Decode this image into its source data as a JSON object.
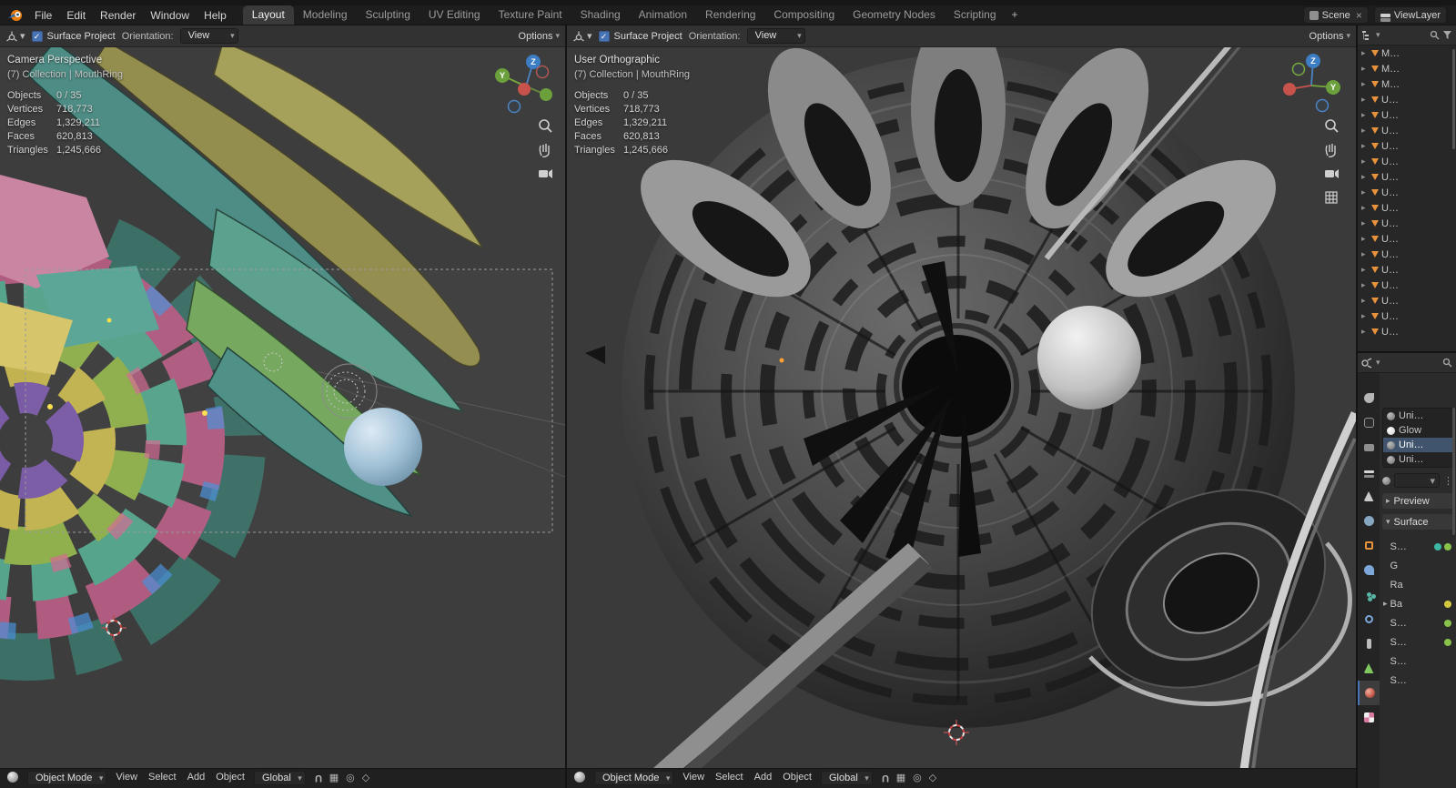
{
  "icons": {
    "chevron": "▾",
    "check": "✓",
    "close": "×",
    "caret_right": "▸",
    "caret_down": "▾",
    "dots": "⋮",
    "proportional": "◎",
    "snap": "▦",
    "falloff": "◇",
    "magnet": "U"
  },
  "topbar": {
    "menus": [
      "File",
      "Edit",
      "Render",
      "Window",
      "Help"
    ],
    "workspaces": [
      {
        "label": "Layout",
        "active": true
      },
      {
        "label": "Modeling"
      },
      {
        "label": "Sculpting"
      },
      {
        "label": "UV Editing"
      },
      {
        "label": "Texture Paint"
      },
      {
        "label": "Shading"
      },
      {
        "label": "Animation"
      },
      {
        "label": "Rendering"
      },
      {
        "label": "Compositing"
      },
      {
        "label": "Geometry Nodes"
      },
      {
        "label": "Scripting"
      }
    ],
    "add_workspace": "+",
    "scene": {
      "label": "Scene"
    },
    "view_layer": {
      "label": "ViewLayer"
    }
  },
  "viewport_left": {
    "header": {
      "surface_project_label": "Surface Project",
      "orientation_label": "Orientation:",
      "orientation_value": "View",
      "options_label": "Options"
    },
    "overlay": {
      "view_name": "Camera Perspective",
      "context": "(7) Collection | MouthRing",
      "stats": [
        {
          "label": "Objects",
          "value": "0 / 35"
        },
        {
          "label": "Vertices",
          "value": "718,773"
        },
        {
          "label": "Edges",
          "value": "1,329,211"
        },
        {
          "label": "Faces",
          "value": "620,813"
        },
        {
          "label": "Triangles",
          "value": "1,245,666"
        }
      ]
    },
    "footer": {
      "mode": "Object Mode",
      "menus": [
        "View",
        "Select",
        "Add",
        "Object"
      ],
      "orientation": "Global"
    }
  },
  "viewport_right": {
    "header": {
      "surface_project_label": "Surface Project",
      "orientation_label": "Orientation:",
      "orientation_value": "View",
      "options_label": "Options"
    },
    "overlay": {
      "view_name": "User Orthographic",
      "context": "(7) Collection | MouthRing",
      "stats": [
        {
          "label": "Objects",
          "value": "0 / 35"
        },
        {
          "label": "Vertices",
          "value": "718,773"
        },
        {
          "label": "Edges",
          "value": "1,329,211"
        },
        {
          "label": "Faces",
          "value": "620,813"
        },
        {
          "label": "Triangles",
          "value": "1,245,666"
        }
      ]
    },
    "footer": {
      "mode": "Object Mode",
      "menus": [
        "View",
        "Select",
        "Add",
        "Object"
      ],
      "orientation": "Global"
    }
  },
  "outliner": {
    "rows": [
      {
        "label": "M…"
      },
      {
        "label": "M…"
      },
      {
        "label": "M…"
      },
      {
        "label": "U…"
      },
      {
        "label": "U…"
      },
      {
        "label": "U…"
      },
      {
        "label": "U…"
      },
      {
        "label": "U…"
      },
      {
        "label": "U…"
      },
      {
        "label": "U…"
      },
      {
        "label": "U…"
      },
      {
        "label": "U…"
      },
      {
        "label": "U…"
      },
      {
        "label": "U…"
      },
      {
        "label": "U…"
      },
      {
        "label": "U…"
      },
      {
        "label": "U…"
      },
      {
        "label": "U…"
      },
      {
        "label": "U…"
      }
    ]
  },
  "properties": {
    "tabs": [
      {
        "name": "tool"
      },
      {
        "name": "render"
      },
      {
        "name": "output"
      },
      {
        "name": "viewlayer"
      },
      {
        "name": "scene"
      },
      {
        "name": "world"
      },
      {
        "name": "object"
      },
      {
        "name": "modifiers"
      },
      {
        "name": "particles"
      },
      {
        "name": "physics"
      },
      {
        "name": "constraints"
      },
      {
        "name": "data"
      },
      {
        "name": "material",
        "active": true
      },
      {
        "name": "texture"
      }
    ],
    "slots": [
      {
        "label": "Uni…",
        "name": "uni1"
      },
      {
        "label": "Glow",
        "name": "glow"
      },
      {
        "label": "Uni…",
        "name": "uni2",
        "active": true
      },
      {
        "label": "Uni…",
        "name": "uni3"
      }
    ],
    "preview_section": "Preview",
    "surface_section": "Surface",
    "fields": [
      {
        "label": "S…",
        "dot": "#88c24a",
        "dot2": "#3eb8a4"
      },
      {
        "label": "G"
      },
      {
        "label": "Ra"
      },
      {
        "label": "Ba",
        "expand": true,
        "dot": "#d4c83e"
      },
      {
        "label": "S…",
        "dot": "#88c24a"
      },
      {
        "label": "S…",
        "dot": "#88c24a"
      },
      {
        "label": "S…"
      },
      {
        "label": "S…"
      }
    ]
  },
  "colors": {
    "accent_blue": "#4772b3",
    "icon_orange": "#e8933c",
    "viewport_bg": "#3d3d3d"
  }
}
